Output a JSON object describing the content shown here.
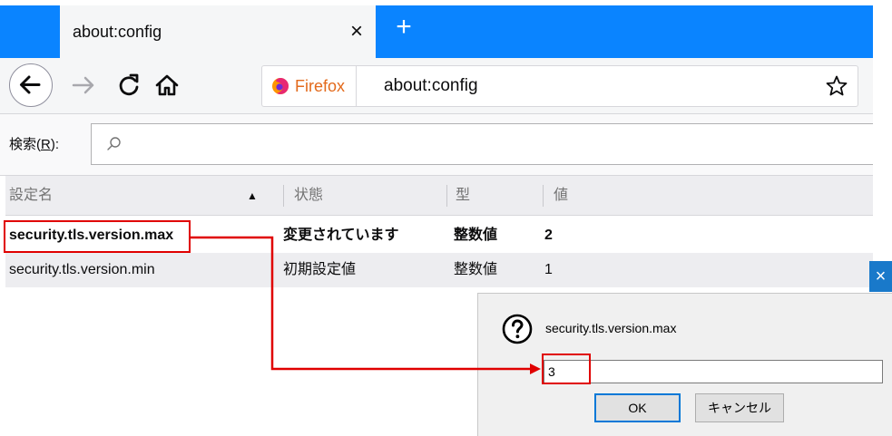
{
  "tab": {
    "title": "about:config",
    "close_glyph": "×",
    "new_tab_glyph": "+"
  },
  "urlbar": {
    "identity_label": "Firefox",
    "url": "about:config"
  },
  "search": {
    "label_prefix": "検索(",
    "label_accel": "R",
    "label_suffix": "):",
    "value": ""
  },
  "table": {
    "headers": {
      "name": "設定名",
      "status": "状態",
      "type": "型",
      "value": "値"
    },
    "rows": [
      {
        "name": "security.tls.version.max",
        "status": "変更されています",
        "type": "整数値",
        "value": "2",
        "modified": true
      },
      {
        "name": "security.tls.version.min",
        "status": "初期設定値",
        "type": "整数値",
        "value": "1",
        "modified": false
      }
    ]
  },
  "dialog": {
    "message": "security.tls.version.max",
    "input_value": "3",
    "ok_label": "OK",
    "cancel_label": "キャンセル",
    "close_glyph": "×"
  },
  "icons": {
    "back": "back-arrow-icon",
    "forward": "forward-arrow-icon",
    "reload": "reload-icon",
    "home": "home-icon",
    "firefox": "firefox-logo-icon",
    "star": "star-icon",
    "search": "search-icon",
    "question": "question-icon"
  },
  "colors": {
    "accent": "#0a84ff",
    "annotation": "#e00000",
    "identity": "#e36a1c"
  }
}
